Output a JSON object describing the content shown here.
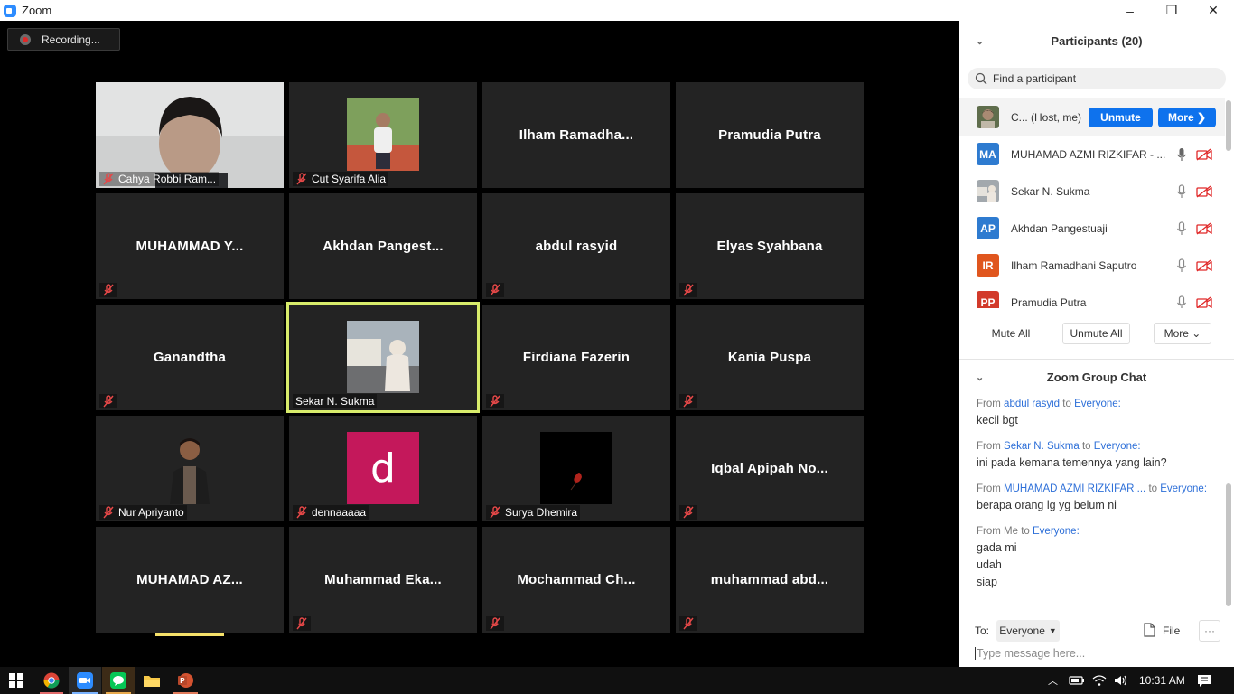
{
  "window": {
    "title": "Zoom",
    "minimize": "–",
    "maximize": "❐",
    "close": "✕"
  },
  "recording": {
    "label": "Recording..."
  },
  "tiles": [
    {
      "name": "Cahya Robbi Ram..."
    },
    {
      "name": "Cut Syarifa Alia"
    },
    {
      "name": "Ilham  Ramadha..."
    },
    {
      "name": "Pramudia Putra"
    },
    {
      "name": "MUHAMMAD  Y..."
    },
    {
      "name": "Akhdan  Pangest..."
    },
    {
      "name": "abdul rasyid"
    },
    {
      "name": "Elyas Syahbana"
    },
    {
      "name": "Ganandtha"
    },
    {
      "name": "Sekar N. Sukma"
    },
    {
      "name": "Firdiana Fazerin"
    },
    {
      "name": "Kania Puspa"
    },
    {
      "name": "Nur Apriyanto"
    },
    {
      "name": "dennaaaaa",
      "avatar_letter": "d"
    },
    {
      "name": "Surya Dhemira"
    },
    {
      "name": "Iqbal  Apipah  No..."
    },
    {
      "name": "MUHAMAD  AZ..."
    },
    {
      "name": "Muhammad  Eka..."
    },
    {
      "name": "Mochammad  Ch..."
    },
    {
      "name": "muhammad  abd..."
    }
  ],
  "participants": {
    "title": "Participants (20)",
    "search_placeholder": "Find a participant",
    "host": {
      "name": "C... (Host, me)",
      "unmute_label": "Unmute",
      "more_label": "More ❯"
    },
    "list": [
      {
        "initials": "MA",
        "name": "MUHAMAD AZMI RIZKIFAR - ...",
        "color": "#2e7bd0"
      },
      {
        "initials": "",
        "name": "Sekar N. Sukma",
        "color": "#8a8f94"
      },
      {
        "initials": "AP",
        "name": "Akhdan Pangestuaji",
        "color": "#2e7bd0"
      },
      {
        "initials": "IR",
        "name": "Ilham Ramadhani Saputro",
        "color": "#e0561e"
      },
      {
        "initials": "PP",
        "name": "Pramudia Putra",
        "color": "#d23a2a"
      }
    ],
    "mute_all": "Mute All",
    "unmute_all": "Unmute All",
    "more": "More ⌄"
  },
  "chat": {
    "title": "Zoom Group Chat",
    "messages": [
      {
        "from_prefix": "From",
        "sender": "abdul rasyid",
        "to_word": "to",
        "recipient": "Everyone:",
        "lines": [
          "kecil bgt"
        ]
      },
      {
        "from_prefix": "From",
        "sender": "Sekar N. Sukma",
        "to_word": "to",
        "recipient": "Everyone:",
        "lines": [
          "ini pada kemana temennya yang lain?"
        ]
      },
      {
        "from_prefix": "From",
        "sender": "MUHAMAD AZMI RIZKIFAR ...",
        "to_word": "to",
        "recipient": "Everyone:",
        "lines": [
          "berapa orang lg yg belum ni"
        ]
      },
      {
        "from_prefix": "From Me",
        "sender": "",
        "to_word": "to",
        "recipient": "Everyone:",
        "lines": [
          "gada mi",
          "udah",
          "siap"
        ]
      }
    ],
    "to_label": "To:",
    "to_value": "Everyone",
    "file_label": "File",
    "more_dots": "···",
    "input_placeholder": "Type message here..."
  },
  "taskbar": {
    "time": "10:31 AM"
  }
}
